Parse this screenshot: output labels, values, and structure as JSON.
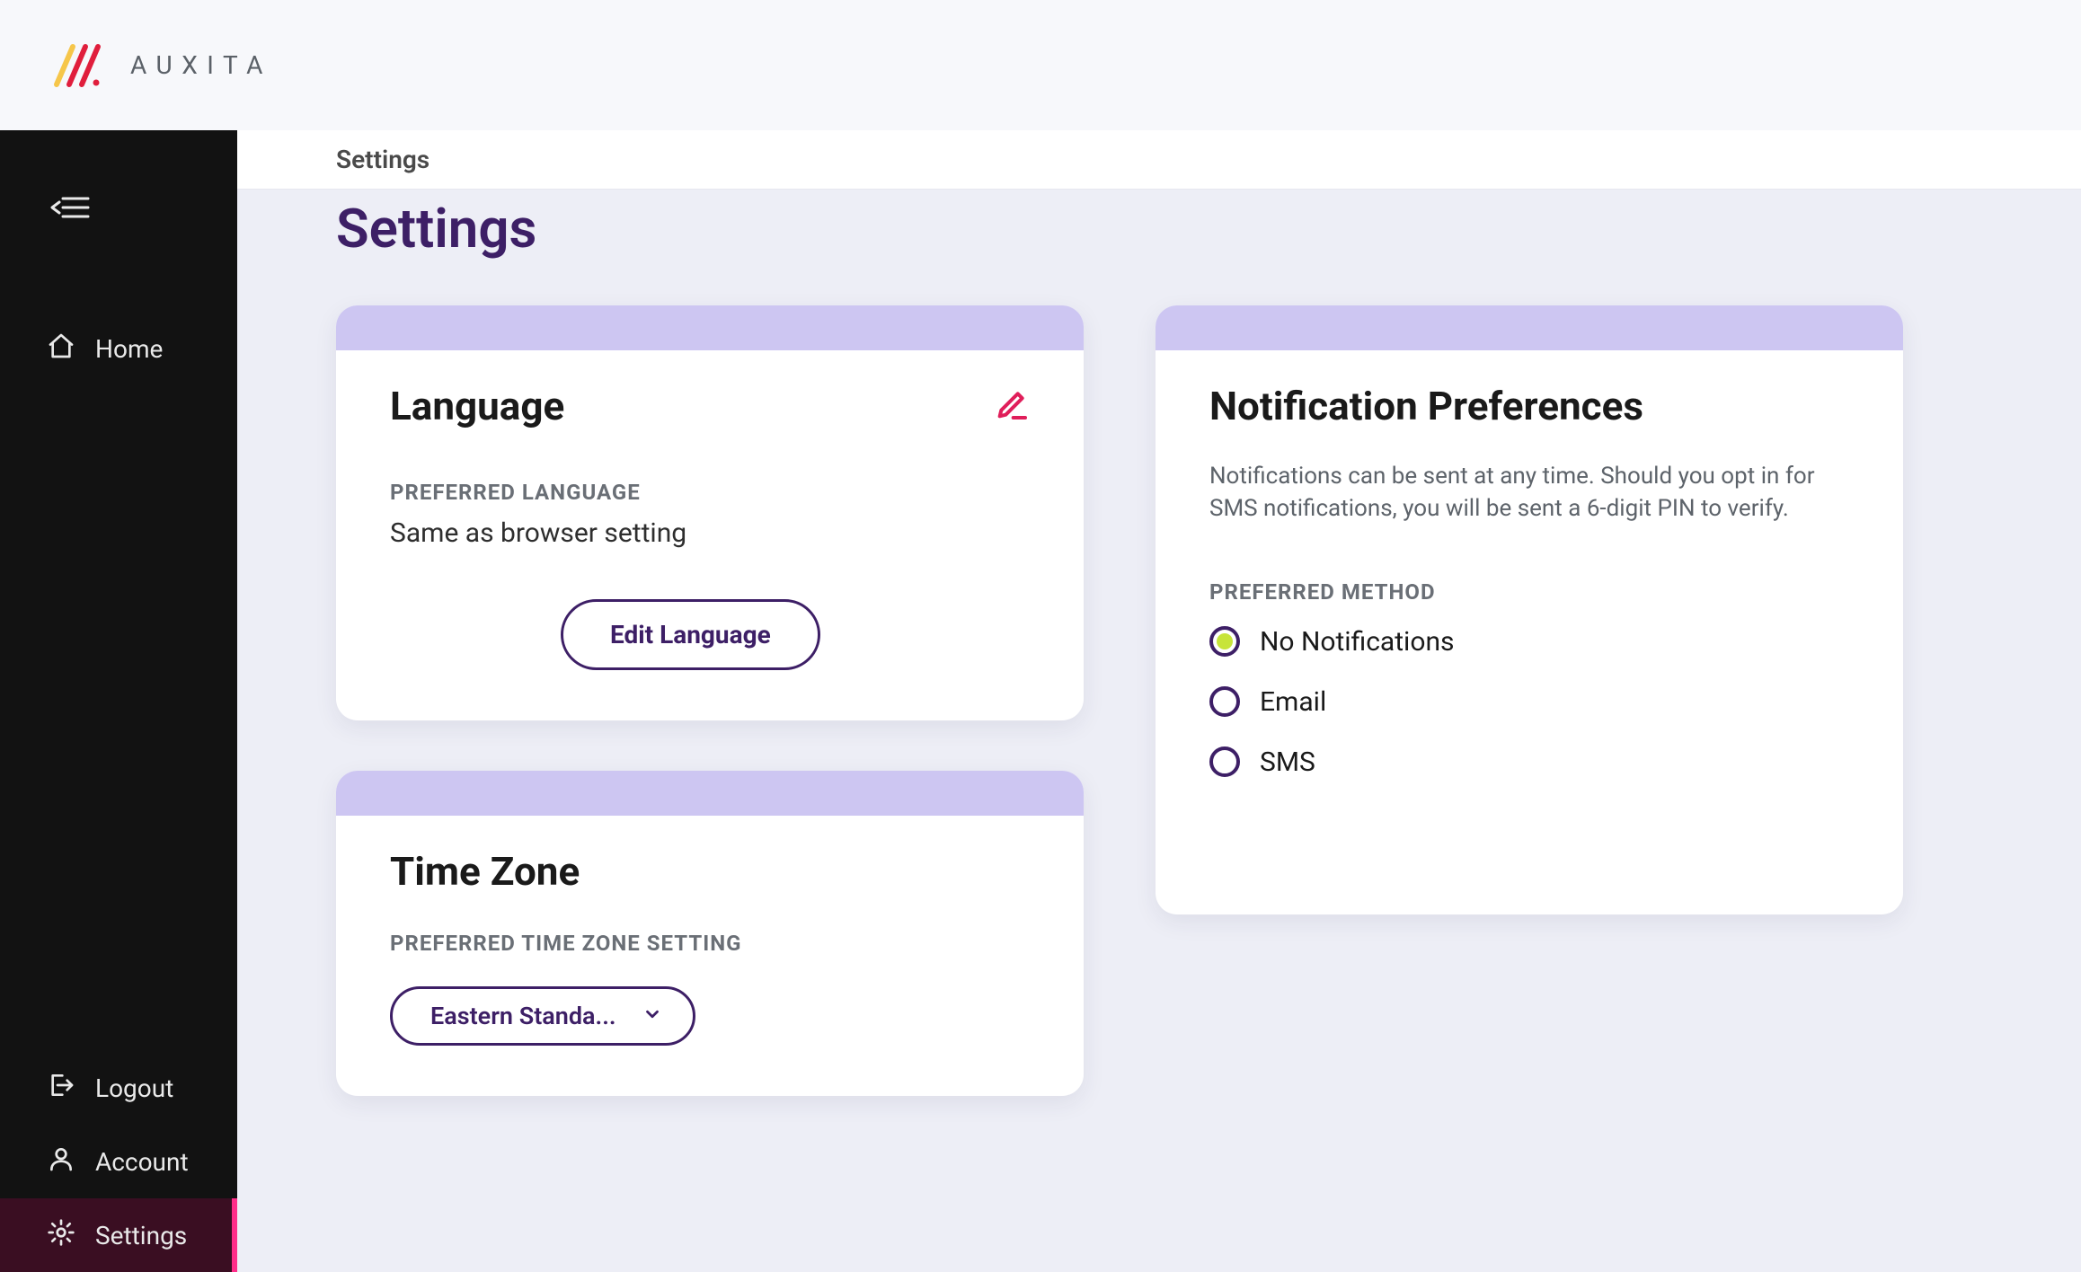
{
  "brand": {
    "name": "AUXITA"
  },
  "sidebar": {
    "items": [
      {
        "id": "home",
        "label": "Home"
      },
      {
        "id": "logout",
        "label": "Logout"
      },
      {
        "id": "account",
        "label": "Account"
      },
      {
        "id": "settings",
        "label": "Settings"
      }
    ]
  },
  "breadcrumb": "Settings",
  "page_title": "Settings",
  "language_card": {
    "title": "Language",
    "subheading": "PREFERRED LANGUAGE",
    "value": "Same as browser setting",
    "edit_button": "Edit Language"
  },
  "timezone_card": {
    "title": "Time Zone",
    "subheading": "PREFERRED TIME ZONE SETTING",
    "selected": "Eastern Standa..."
  },
  "notifications_card": {
    "title": "Notification Preferences",
    "description": "Notifications can be sent at any time. Should you opt in for SMS notifications, you will be sent a 6-digit PIN to verify.",
    "subheading": "PREFERRED METHOD",
    "options": [
      {
        "label": "No Notifications",
        "checked": true
      },
      {
        "label": "Email",
        "checked": false
      },
      {
        "label": "SMS",
        "checked": false
      }
    ]
  }
}
